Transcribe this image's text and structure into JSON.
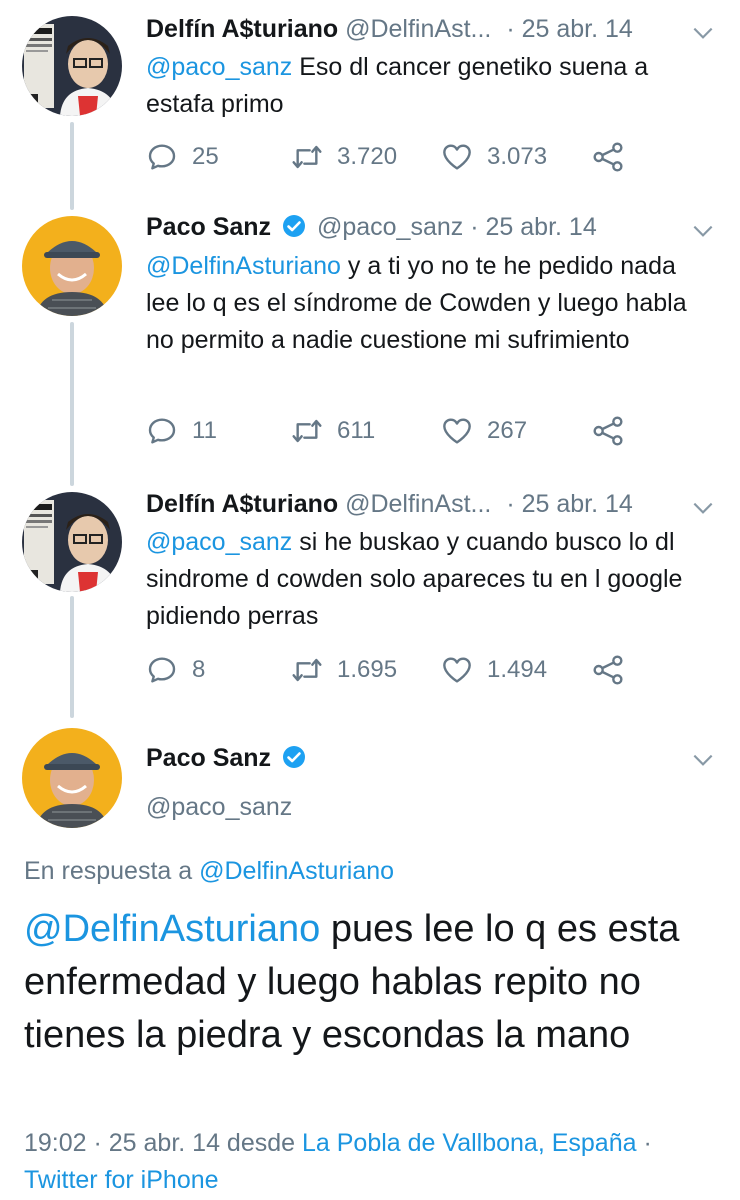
{
  "tweets": [
    {
      "name": "Delfín A$turiano",
      "handle": "@DelfinAst...",
      "dot": "·",
      "date": "25 abr. 14",
      "mention": "@paco_sanz",
      "body": " Eso dl cancer genetiko suena a estafa primo",
      "replies": "25",
      "retweets": "3.720",
      "likes": "3.073"
    },
    {
      "name": "Paco Sanz",
      "handle": "@paco_sanz",
      "dot": "·",
      "date": "25 abr. 14",
      "mention": "@DelfinAsturiano",
      "body": " y a ti yo no te he pedido nada lee lo q es el síndrome de Cowden y luego habla no permito a nadie cuestione mi sufrimiento",
      "replies": "11",
      "retweets": "611",
      "likes": "267"
    },
    {
      "name": "Delfín A$turiano",
      "handle": "@DelfinAst...",
      "dot": "·",
      "date": "25 abr. 14",
      "mention": "@paco_sanz",
      "body": " si he buskao y cuando busco lo dl sindrome d cowden solo apareces tu en l google pidiendo perras",
      "replies": "8",
      "retweets": "1.695",
      "likes": "1.494"
    }
  ],
  "main": {
    "name": "Paco Sanz",
    "handle": "@paco_sanz",
    "reply_prefix": "En respuesta a ",
    "reply_handle": "@DelfinAsturiano",
    "mention": "@DelfinAsturiano",
    "body": " pues lee lo q es esta enfermedad y luego hablas repito no tienes la piedra y escondas la mano",
    "time": "19:02 · 25 abr. 14 desde ",
    "location": "La Pobla de Vallbona, España",
    "sep": " · ",
    "client": "Twitter for iPhone"
  },
  "colors": {
    "link": "#1b95e0",
    "secondary": "#657786",
    "text": "#14171a",
    "thread": "#ccd6dd"
  },
  "icons": [
    "reply-icon",
    "retweet-icon",
    "like-icon",
    "share-icon",
    "verified-badge-icon",
    "chevron-down-icon"
  ]
}
